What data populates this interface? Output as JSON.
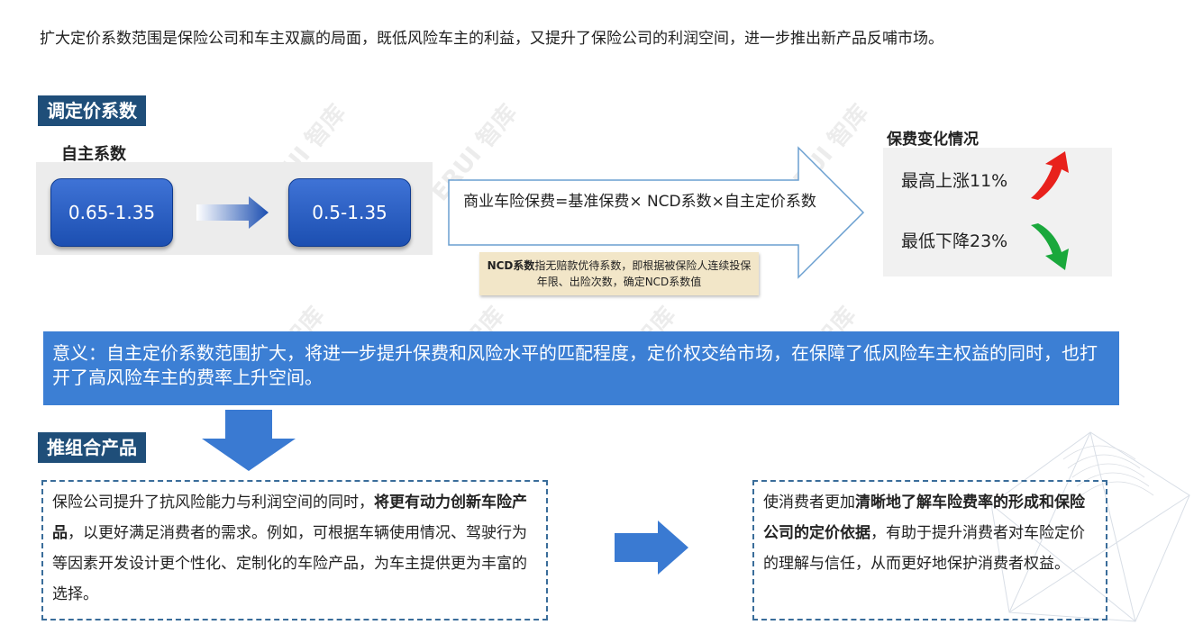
{
  "intro": "扩大定价系数范围是保险公司和车主双赢的局面，既低风险车主的利益，又提升了保险公司的利润空间，进一步推出新产品反哺市场。",
  "section1": {
    "title": "调定价系数",
    "sub_title": "自主系数",
    "coef_from": "0.65-1.35",
    "coef_to": "0.5-1.35",
    "formula": "商业车险保费=基准保费× NCD系数×自主定价系数",
    "note_bold": "NCD系数",
    "note_rest": "指无赔款优待系数，即根据被保险人连续投保年限、出险次数，确定NCD系数值"
  },
  "premium": {
    "title": "保费变化情况",
    "up": "最高上涨11%",
    "down": "最低下降23%",
    "up_color": "#e8211c",
    "down_color": "#1aa83c"
  },
  "meaning": "意义：自主定价系数范围扩大，将进一步提升保费和风险水平的匹配程度，定价权交给市场，在保障了低风险车主权益的同时，也打开了高风险车主的费率上升空间。",
  "section2": {
    "title": "推组合产品",
    "box1_a": "保险公司提升了抗风险能力与利润空间的同时，",
    "box1_bold": "将更有动力创新车险产品",
    "box1_b": "，以更好满足消费者的需求。例如，可根据车辆使用情况、驾驶行为等因素开发设计更个性化、定制化的车险产品，为车主提供更为丰富的选择。",
    "box2_a": "使消费者更加",
    "box2_bold": "清晰地了解车险费率的形成和保险公司的定价依据",
    "box2_b": "，有助于提升消费者对车险定价的理解与信任，从而更好地保护消费者权益。"
  },
  "watermarks": [
    "ERUI 智库",
    "ERUI 智库",
    "ERUI 智库",
    "智库",
    "智库",
    "智库",
    "智库"
  ],
  "colors": {
    "section_label": "#1f4e79",
    "meaning_bg": "#3c7fd4",
    "coef_box": "#2a5fc4",
    "arrow": "#3a7ad2"
  }
}
